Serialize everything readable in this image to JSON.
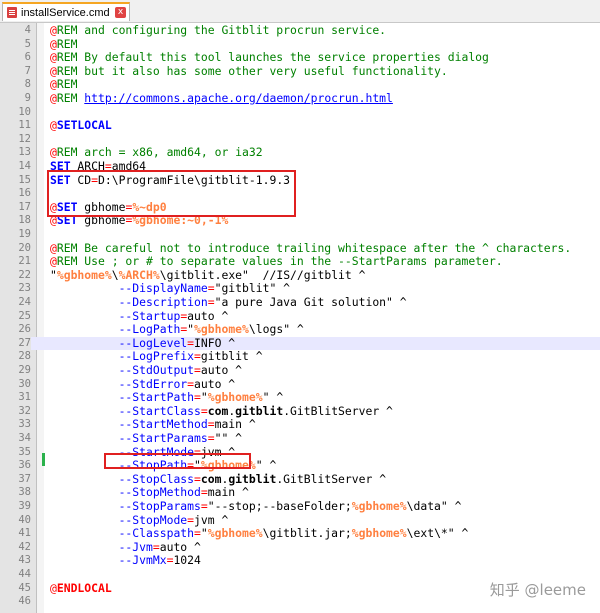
{
  "tab": {
    "title": "installService.cmd",
    "close_glyph": "x"
  },
  "lines": [
    {
      "n": "4",
      "parts": [
        [
          "at",
          "@"
        ],
        [
          "cm",
          "REM and configuring the Gitblit procrun service."
        ]
      ]
    },
    {
      "n": "5",
      "parts": [
        [
          "at",
          "@"
        ],
        [
          "cm",
          "REM"
        ]
      ]
    },
    {
      "n": "6",
      "parts": [
        [
          "at",
          "@"
        ],
        [
          "cm",
          "REM By default this tool launches the service properties dialog"
        ]
      ]
    },
    {
      "n": "7",
      "parts": [
        [
          "at",
          "@"
        ],
        [
          "cm",
          "REM but it also has some other very useful functionality."
        ]
      ]
    },
    {
      "n": "8",
      "parts": [
        [
          "at",
          "@"
        ],
        [
          "cm",
          "REM"
        ]
      ]
    },
    {
      "n": "9",
      "parts": [
        [
          "at",
          "@"
        ],
        [
          "cm",
          "REM "
        ],
        [
          "url",
          "http://commons.apache.org/daemon/procrun.html"
        ]
      ]
    },
    {
      "n": "10",
      "parts": []
    },
    {
      "n": "11",
      "parts": [
        [
          "at",
          "@"
        ],
        [
          "kw",
          "SETLOCAL"
        ]
      ]
    },
    {
      "n": "12",
      "parts": []
    },
    {
      "n": "13",
      "parts": [
        [
          "at",
          "@"
        ],
        [
          "cm",
          "REM arch = x86, amd64, or ia32"
        ]
      ]
    },
    {
      "n": "14",
      "parts": [
        [
          "kw",
          "SET"
        ],
        [
          "txt",
          " ARCH"
        ],
        [
          "op",
          "="
        ],
        [
          "txt",
          "amd64"
        ]
      ]
    },
    {
      "n": "15",
      "parts": [
        [
          "kw",
          "SET"
        ],
        [
          "txt",
          " CD"
        ],
        [
          "op",
          "="
        ],
        [
          "txt",
          "D:\\ProgramFile\\gitblit-1.9.3"
        ]
      ]
    },
    {
      "n": "16",
      "parts": []
    },
    {
      "n": "17",
      "parts": [
        [
          "at",
          "@"
        ],
        [
          "kw",
          "SET"
        ],
        [
          "txt",
          " gbhome"
        ],
        [
          "op",
          "="
        ],
        [
          "var",
          "%~dp0"
        ]
      ]
    },
    {
      "n": "18",
      "parts": [
        [
          "at",
          "@"
        ],
        [
          "kw",
          "SET"
        ],
        [
          "txt",
          " gbhome"
        ],
        [
          "op",
          "="
        ],
        [
          "var",
          "%gbhome:~0,-1%"
        ]
      ]
    },
    {
      "n": "19",
      "parts": []
    },
    {
      "n": "20",
      "parts": [
        [
          "at",
          "@"
        ],
        [
          "cm",
          "REM Be careful not to introduce trailing whitespace after the ^ characters."
        ]
      ]
    },
    {
      "n": "21",
      "parts": [
        [
          "at",
          "@"
        ],
        [
          "cm",
          "REM Use ; or # to separate values in the --StartParams parameter."
        ]
      ]
    },
    {
      "n": "22",
      "parts": [
        [
          "txt",
          "\""
        ],
        [
          "var",
          "%gbhome%"
        ],
        [
          "txt",
          "\\"
        ],
        [
          "var",
          "%ARCH%"
        ],
        [
          "txt",
          "\\gitblit.exe\"  //IS//gitblit ^"
        ]
      ]
    },
    {
      "n": "23",
      "parts": [
        [
          "txt",
          "          "
        ],
        [
          "pm",
          "--DisplayName"
        ],
        [
          "op",
          "="
        ],
        [
          "txt",
          "\"gitblit\" ^"
        ]
      ]
    },
    {
      "n": "24",
      "parts": [
        [
          "txt",
          "          "
        ],
        [
          "pm",
          "--Description"
        ],
        [
          "op",
          "="
        ],
        [
          "txt",
          "\"a pure Java Git solution\" ^"
        ]
      ]
    },
    {
      "n": "25",
      "parts": [
        [
          "txt",
          "          "
        ],
        [
          "pm",
          "--Startup"
        ],
        [
          "op",
          "="
        ],
        [
          "txt",
          "auto ^"
        ]
      ]
    },
    {
      "n": "26",
      "parts": [
        [
          "txt",
          "          "
        ],
        [
          "pm",
          "--LogPath"
        ],
        [
          "op",
          "="
        ],
        [
          "txt",
          "\""
        ],
        [
          "var",
          "%gbhome%"
        ],
        [
          "txt",
          "\\logs\" ^"
        ]
      ]
    },
    {
      "n": "27",
      "parts": [
        [
          "txt",
          "          "
        ],
        [
          "pm",
          "--LogLevel"
        ],
        [
          "op",
          "="
        ],
        [
          "txt",
          "INFO ^"
        ]
      ]
    },
    {
      "n": "28",
      "parts": [
        [
          "txt",
          "          "
        ],
        [
          "pm",
          "--LogPrefix"
        ],
        [
          "op",
          "="
        ],
        [
          "txt",
          "gitblit ^"
        ]
      ]
    },
    {
      "n": "29",
      "parts": [
        [
          "txt",
          "          "
        ],
        [
          "pm",
          "--StdOutput"
        ],
        [
          "op",
          "="
        ],
        [
          "txt",
          "auto ^"
        ]
      ]
    },
    {
      "n": "30",
      "parts": [
        [
          "txt",
          "          "
        ],
        [
          "pm",
          "--StdError"
        ],
        [
          "op",
          "="
        ],
        [
          "txt",
          "auto ^"
        ]
      ]
    },
    {
      "n": "31",
      "parts": [
        [
          "txt",
          "          "
        ],
        [
          "pm",
          "--StartPath"
        ],
        [
          "op",
          "="
        ],
        [
          "txt",
          "\""
        ],
        [
          "var",
          "%gbhome%"
        ],
        [
          "txt",
          "\" ^"
        ]
      ]
    },
    {
      "n": "32",
      "parts": [
        [
          "txt",
          "          "
        ],
        [
          "pm",
          "--StartClass"
        ],
        [
          "op",
          "="
        ],
        [
          "bx",
          "com"
        ],
        [
          "txt",
          "."
        ],
        [
          "bx",
          "gitblit"
        ],
        [
          "txt",
          ".GitBlitServer ^"
        ]
      ]
    },
    {
      "n": "33",
      "parts": [
        [
          "txt",
          "          "
        ],
        [
          "pm",
          "--StartMethod"
        ],
        [
          "op",
          "="
        ],
        [
          "txt",
          "main ^"
        ]
      ]
    },
    {
      "n": "34",
      "parts": [
        [
          "txt",
          "          "
        ],
        [
          "pm",
          "--StartParams"
        ],
        [
          "op",
          "="
        ],
        [
          "txt",
          "\"\" ^"
        ]
      ]
    },
    {
      "n": "35",
      "parts": [
        [
          "txt",
          "          "
        ],
        [
          "pm",
          "--StartMode"
        ],
        [
          "op",
          "="
        ],
        [
          "txt",
          "jvm ^"
        ]
      ]
    },
    {
      "n": "36",
      "parts": [
        [
          "txt",
          "          "
        ],
        [
          "pm",
          "--StopPath"
        ],
        [
          "op",
          "="
        ],
        [
          "txt",
          "\""
        ],
        [
          "var",
          "%gbhome%"
        ],
        [
          "txt",
          "\" ^"
        ]
      ]
    },
    {
      "n": "37",
      "parts": [
        [
          "txt",
          "          "
        ],
        [
          "pm",
          "--StopClass"
        ],
        [
          "op",
          "="
        ],
        [
          "bx",
          "com"
        ],
        [
          "txt",
          "."
        ],
        [
          "bx",
          "gitblit"
        ],
        [
          "txt",
          ".GitBlitServer ^"
        ]
      ]
    },
    {
      "n": "38",
      "parts": [
        [
          "txt",
          "          "
        ],
        [
          "pm",
          "--StopMethod"
        ],
        [
          "op",
          "="
        ],
        [
          "txt",
          "main ^"
        ]
      ]
    },
    {
      "n": "39",
      "parts": [
        [
          "txt",
          "          "
        ],
        [
          "pm",
          "--StopParams"
        ],
        [
          "op",
          "="
        ],
        [
          "txt",
          "\"--stop;--baseFolder;"
        ],
        [
          "var",
          "%gbhome%"
        ],
        [
          "txt",
          "\\data\" ^"
        ]
      ]
    },
    {
      "n": "40",
      "parts": [
        [
          "txt",
          "          "
        ],
        [
          "pm",
          "--StopMode"
        ],
        [
          "op",
          "="
        ],
        [
          "txt",
          "jvm ^"
        ]
      ]
    },
    {
      "n": "41",
      "parts": [
        [
          "txt",
          "          "
        ],
        [
          "pm",
          "--Classpath"
        ],
        [
          "op",
          "="
        ],
        [
          "txt",
          "\""
        ],
        [
          "var",
          "%gbhome%"
        ],
        [
          "txt",
          "\\gitblit.jar;"
        ],
        [
          "var",
          "%gbhome%"
        ],
        [
          "txt",
          "\\ext\\*\" ^"
        ]
      ]
    },
    {
      "n": "42",
      "parts": [
        [
          "txt",
          "          "
        ],
        [
          "pm",
          "--Jvm"
        ],
        [
          "op",
          "="
        ],
        [
          "txt",
          "auto ^"
        ]
      ]
    },
    {
      "n": "43",
      "parts": [
        [
          "txt",
          "          "
        ],
        [
          "pm",
          "--JvmMx"
        ],
        [
          "op",
          "="
        ],
        [
          "txt",
          "1024"
        ]
      ]
    },
    {
      "n": "44",
      "parts": []
    },
    {
      "n": "45",
      "parts": [
        [
          "at",
          "@"
        ],
        [
          "lbl",
          "ENDLOCAL"
        ]
      ]
    },
    {
      "n": "46",
      "parts": []
    }
  ],
  "current_line": "27",
  "watermark": {
    "text": "知乎 @leeme"
  },
  "colors": {
    "comment": "#008000",
    "keyword": "#0000ff",
    "variable": "#ff8040",
    "highlight_box": "#e02020",
    "current_line": "#e8e8ff"
  }
}
